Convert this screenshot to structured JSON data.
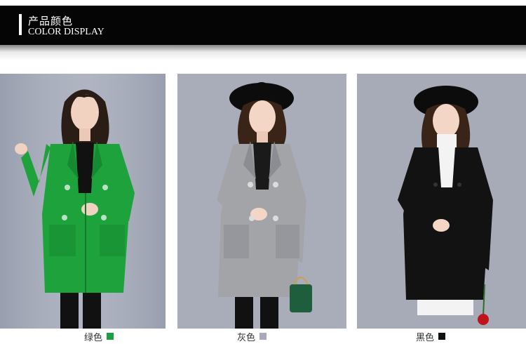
{
  "header": {
    "title_cn": "产品颜色",
    "title_en": "COLOR DISPLAY"
  },
  "variants": [
    {
      "label": "绿色",
      "swatch": "#1f9e45",
      "coat": "#1ea23c",
      "coat_shade": "#168a30",
      "bg": "#a7acbb",
      "inner": "#111111",
      "hat": false
    },
    {
      "label": "灰色",
      "swatch": "#a9a9bd",
      "coat": "#a3a4a8",
      "coat_shade": "#8c8d92",
      "bg": "#a9adb9",
      "inner": "#1a1a1a",
      "hat": true
    },
    {
      "label": "黑色",
      "swatch": "#111111",
      "coat": "#121212",
      "coat_shade": "#000000",
      "bg": "#a7abb8",
      "inner": "#f3f3f3",
      "hat": true
    }
  ],
  "icons": {
    "header_bar": "vertical-bar-icon"
  }
}
